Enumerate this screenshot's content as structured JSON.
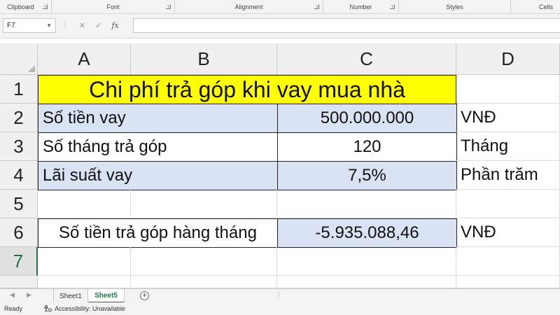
{
  "ribbon": {
    "groups": [
      {
        "label": "Clipboard"
      },
      {
        "label": "Font"
      },
      {
        "label": "Alignment"
      },
      {
        "label": "Number"
      },
      {
        "label": "Styles"
      },
      {
        "label": "Cells"
      }
    ]
  },
  "formula_bar": {
    "name_box": "F7",
    "formula": ""
  },
  "grid": {
    "columns": [
      "A",
      "B",
      "C",
      "D"
    ],
    "rows": [
      "1",
      "2",
      "3",
      "4",
      "5",
      "6",
      "7"
    ],
    "active_row": "7",
    "cells": {
      "title": "Chi phí trả góp khi vay mua nhà",
      "r2_label": "Số tiền vay",
      "r2_value": "500.000.000",
      "r2_unit": "VNĐ",
      "r3_label": "Số tháng trả góp",
      "r3_value": "120",
      "r3_unit": "Tháng",
      "r4_label": "Lãi suất vay",
      "r4_value": "7,5%",
      "r4_unit": "Phần trăm",
      "r6_label": "Số tiền trả góp hàng tháng",
      "r6_value": "-5.935.088,46",
      "r6_unit": "VNĐ"
    }
  },
  "sheets": {
    "tabs": [
      {
        "label": "Sheet1",
        "active": false
      },
      {
        "label": "Sheet5",
        "active": true
      }
    ]
  },
  "status_bar": {
    "ready": "Ready",
    "accessibility": "Accessibility: Unavailable"
  },
  "colors": {
    "title_fill": "#ffff00",
    "shade_fill": "#dae3f3",
    "accent": "#217346"
  }
}
